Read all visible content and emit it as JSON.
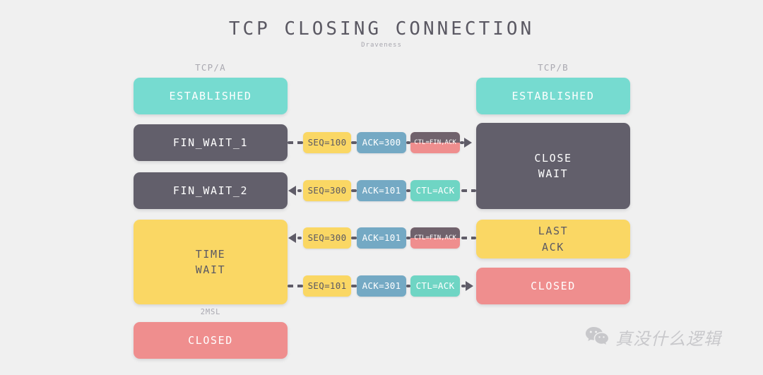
{
  "page": {
    "title": "TCP CLOSING CONNECTION",
    "subtitle": "Draveness",
    "background_color": "#f0f0f0"
  },
  "colors": {
    "established": "#76dbd0",
    "dark_state": "#625f6b",
    "time_wait": "#fad764",
    "closed": "#ef8e8e",
    "seq_badge": "#fad764",
    "ack_badge": "#74a9c4",
    "ctl_ack_badge": "#6fd5c4",
    "ctl_finack_badge": "#ef8e8e",
    "connector": "#5f5c68",
    "muted_text": "#a9a8b0",
    "title_text": "#5b5963"
  },
  "columns": {
    "left": {
      "label": "TCP/A"
    },
    "right": {
      "label": "TCP/B"
    }
  },
  "left_states": [
    {
      "name": "established",
      "lines": [
        "ESTABLISHED"
      ]
    },
    {
      "name": "fin-wait-1",
      "lines": [
        "FIN_WAIT_1"
      ]
    },
    {
      "name": "fin-wait-2",
      "lines": [
        "FIN_WAIT_2"
      ]
    },
    {
      "name": "time-wait",
      "lines": [
        "TIME",
        "WAIT"
      ]
    },
    {
      "name": "closed",
      "lines": [
        "CLOSED"
      ]
    }
  ],
  "left_caption": "2MSL",
  "right_states": [
    {
      "name": "established",
      "lines": [
        "ESTABLISHED"
      ]
    },
    {
      "name": "close-wait",
      "lines": [
        "CLOSE",
        "WAIT"
      ]
    },
    {
      "name": "last-ack",
      "lines": [
        "LAST",
        "ACK"
      ]
    },
    {
      "name": "closed",
      "lines": [
        "CLOSED"
      ]
    }
  ],
  "messages": [
    {
      "direction": "right",
      "seq": "SEQ=100",
      "ack": "ACK=300",
      "ctl": "CTL=FIN,ACK"
    },
    {
      "direction": "left",
      "seq": "SEQ=300",
      "ack": "ACK=101",
      "ctl": "CTL=ACK"
    },
    {
      "direction": "left",
      "seq": "SEQ=300",
      "ack": "ACK=101",
      "ctl": "CTL=FIN,ACK"
    },
    {
      "direction": "right",
      "seq": "SEQ=101",
      "ack": "ACK=301",
      "ctl": "CTL=ACK"
    }
  ],
  "watermark": {
    "icon": "wechat-icon",
    "text": "真没什么逻辑"
  }
}
